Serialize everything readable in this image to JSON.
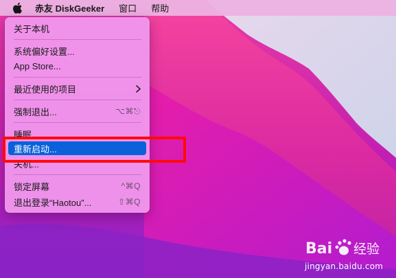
{
  "menubar": {
    "app_name": "赤友 DiskGeeker",
    "items": [
      {
        "label": "窗口"
      },
      {
        "label": "帮助"
      }
    ]
  },
  "apple_menu": {
    "items": [
      {
        "label": "关于本机",
        "shortcut": ""
      },
      {
        "label": "系统偏好设置...",
        "shortcut": ""
      },
      {
        "label": "App Store...",
        "shortcut": ""
      },
      {
        "label": "最近使用的项目",
        "shortcut": ""
      },
      {
        "label": "强制退出...",
        "shortcut": "⌥⌘⎋"
      },
      {
        "label": "睡眠",
        "shortcut": ""
      },
      {
        "label": "重新启动...",
        "shortcut": ""
      },
      {
        "label": "关机...",
        "shortcut": ""
      },
      {
        "label": "锁定屏幕",
        "shortcut": "^⌘Q"
      },
      {
        "label": "退出登录“Haotou”...",
        "shortcut": "⇧⌘Q"
      }
    ],
    "highlighted": "重新启动..."
  },
  "watermark": {
    "logo_text": "Bai 经验",
    "url": "jingyan.baidu.com"
  },
  "colors": {
    "highlight": "#0a61d9",
    "annotation_box": "#ff0a0a"
  }
}
